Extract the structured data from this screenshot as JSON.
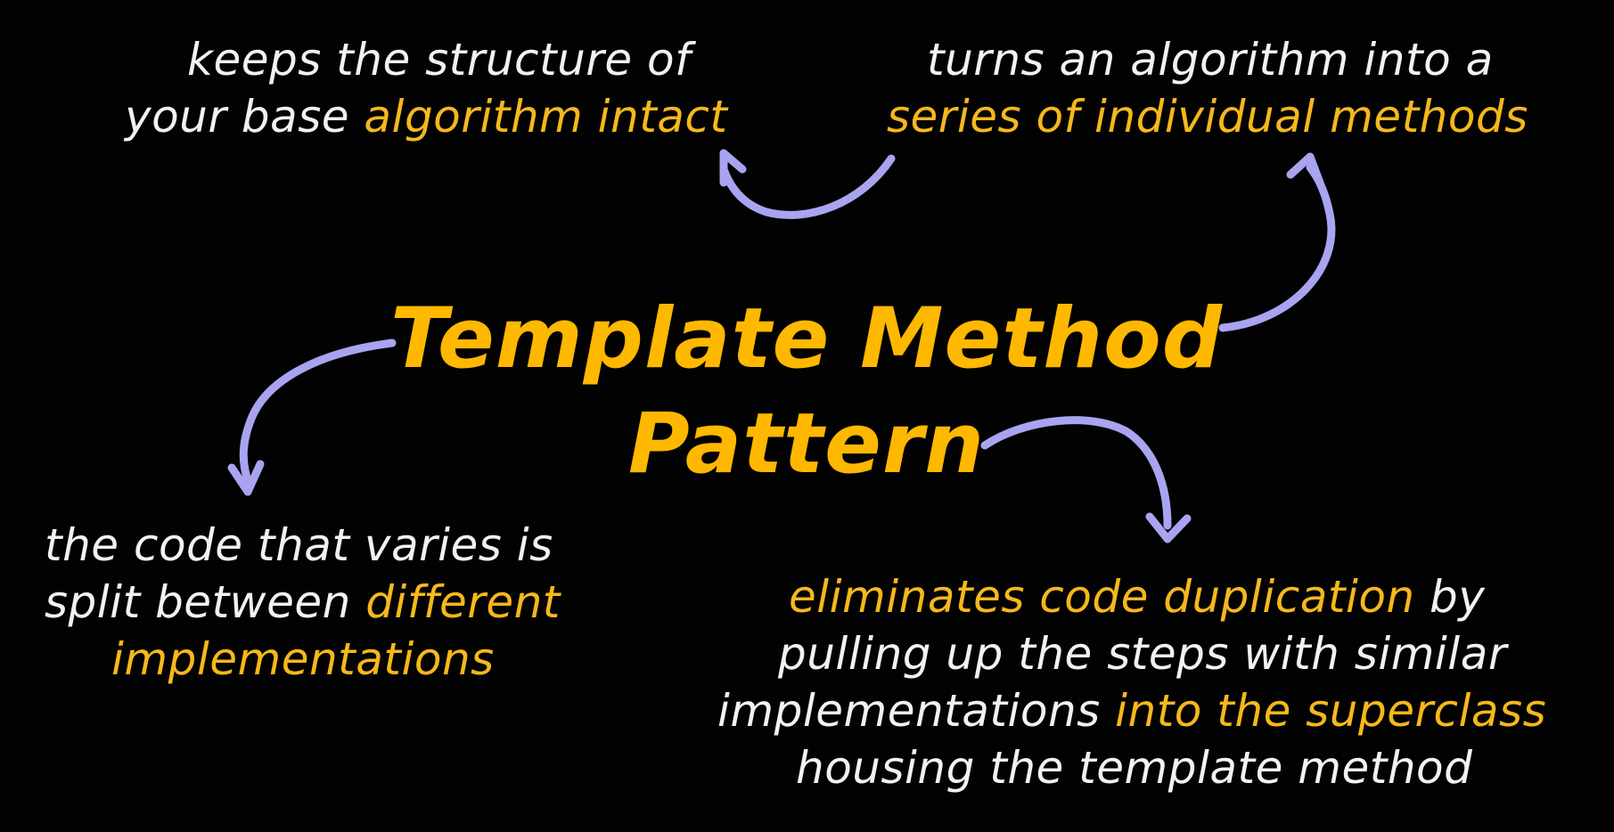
{
  "title": {
    "line1": "Template Method",
    "line2": "Pattern"
  },
  "notes": {
    "top_left": {
      "line1_a": "keeps the structure of",
      "line2_a": "your base ",
      "line2_hl": "algorithm intact"
    },
    "top_right": {
      "line1_a": "turns an algorithm into a",
      "line2_hl": "series of individual methods"
    },
    "bottom_left": {
      "line1_a": "the code that varies is",
      "line2_a": "split between ",
      "line2_hl": "different",
      "line3_hl": "implementations"
    },
    "bottom_right": {
      "line1_hl": "eliminates code duplication",
      "line1_b": " by",
      "line2_a": "pulling up the steps with similar",
      "line3_a": "implementations ",
      "line3_hl": "into the superclass",
      "line4_a": "housing the template method"
    }
  },
  "colors": {
    "background": "#020202",
    "text": "#f2f2f2",
    "highlight": "#f6b81c",
    "title": "#ffb800",
    "arrow": "#a9a4f0"
  }
}
